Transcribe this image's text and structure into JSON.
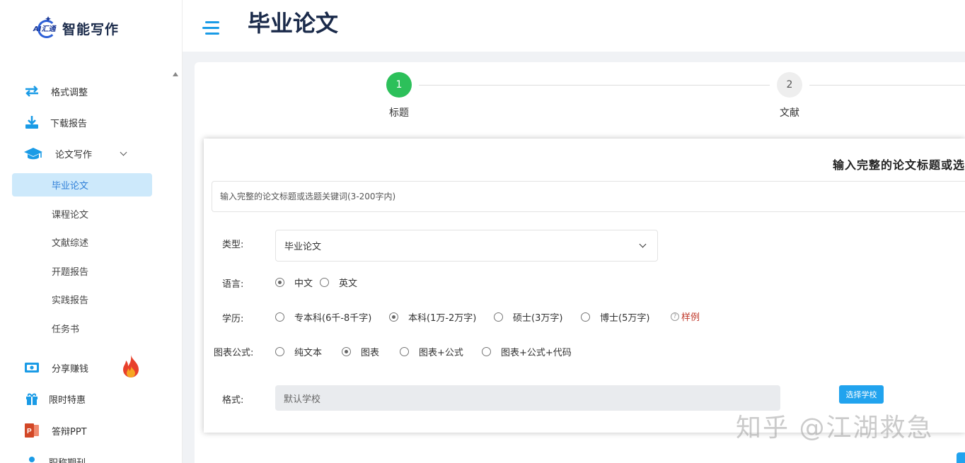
{
  "app": {
    "logo_text": "AI汇通",
    "logo_title": "智能写作"
  },
  "sidebar": {
    "items": [
      {
        "label": "格式调整",
        "icon": "swap-arrows-icon"
      },
      {
        "label": "下载报告",
        "icon": "download-icon"
      },
      {
        "label": "论文写作",
        "icon": "graduation-cap-icon",
        "expanded": true
      }
    ],
    "sub_items": [
      {
        "label": "毕业论文",
        "active": true
      },
      {
        "label": "课程论文"
      },
      {
        "label": "文献综述"
      },
      {
        "label": "开题报告"
      },
      {
        "label": "实践报告"
      },
      {
        "label": "任务书"
      }
    ],
    "extra_items": [
      {
        "label": "分享赚钱",
        "icon": "money-icon",
        "badge_icon": "fire-icon"
      },
      {
        "label": "限时特惠",
        "icon": "gift-icon"
      },
      {
        "label": "答辩PPT",
        "icon": "ppt-icon"
      },
      {
        "label": "职称期刊",
        "icon": "user-icon"
      }
    ]
  },
  "header": {
    "title": "毕业论文"
  },
  "steps": [
    {
      "number": "1",
      "label": "标题",
      "active": true
    },
    {
      "number": "2",
      "label": "文献",
      "active": false
    }
  ],
  "form": {
    "heading": "输入完整的论文标题或选",
    "title_placeholder": "输入完整的论文标题或选题关键词(3-200字内)",
    "type": {
      "label": "类型:",
      "selected": "毕业论文"
    },
    "language": {
      "label": "语言:",
      "options": [
        {
          "label": "中文",
          "checked": true
        },
        {
          "label": "英文",
          "checked": false
        }
      ]
    },
    "degree": {
      "label": "学历:",
      "options": [
        {
          "label": "专本科(6千-8千字)",
          "checked": false
        },
        {
          "label": "本科(1万-2万字)",
          "checked": true
        },
        {
          "label": "硕士(3万字)",
          "checked": false
        },
        {
          "label": "博士(5万字)",
          "checked": false
        }
      ],
      "example_label": "样例"
    },
    "chart": {
      "label": "图表公式:",
      "options": [
        {
          "label": "纯文本",
          "checked": false
        },
        {
          "label": "图表",
          "checked": true
        },
        {
          "label": "图表+公式",
          "checked": false
        },
        {
          "label": "图表+公式+代码",
          "checked": false
        }
      ]
    },
    "format": {
      "label": "格式:",
      "value": "默认学校",
      "button": "选择学校"
    }
  },
  "watermark": "知乎 @江湖救急",
  "colors": {
    "accent": "#21a3ee",
    "step_active": "#2cc05a",
    "active_nav_bg": "#cde9fb",
    "example_red": "#c0392b"
  }
}
